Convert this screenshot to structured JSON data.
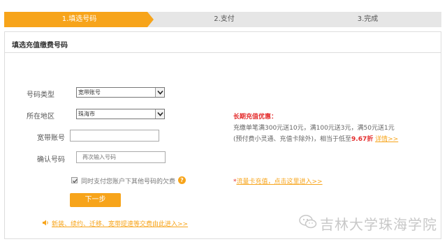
{
  "steps": [
    {
      "label": "1.填选号码",
      "active": true
    },
    {
      "label": "2.支付",
      "active": false
    },
    {
      "label": "3.完成",
      "active": false
    }
  ],
  "panel": {
    "title": "填选充值缴费号码"
  },
  "form": {
    "number_type_label": "号码类型",
    "number_type_value": "宽带账号",
    "region_label": "所在地区",
    "region_value": "珠海市",
    "account_label": "宽带账号",
    "account_value": "",
    "confirm_label": "确认号码",
    "confirm_placeholder": "再次输入号码",
    "pay_others_label": "同时支付您账户下其他号码的欠费",
    "pay_others_checked": true,
    "help_icon": "?",
    "next_button": "下一步"
  },
  "notice": {
    "icon": "speaker-icon",
    "text": "新装、续约、迁移、宽带提速等交费由此进入>>"
  },
  "promo": {
    "title": "长期充值优惠：",
    "line1": "充缴单笔满300元送10元，满100元送3元，满50元送1元",
    "line2_prefix": "(预付费小灵通、充值卡除外)，相当于低至",
    "discount": "9.67折",
    "details_link": "详情>>"
  },
  "flow": {
    "star": "*",
    "link": "流量卡充值，点击这里进入>>"
  },
  "watermark": {
    "text": "吉林大学珠海学院",
    "icon": "wechat-icon"
  },
  "colors": {
    "accent": "#f7a41a",
    "promo_red": "#e42c2c",
    "step_inactive": "#e6e6e6"
  }
}
